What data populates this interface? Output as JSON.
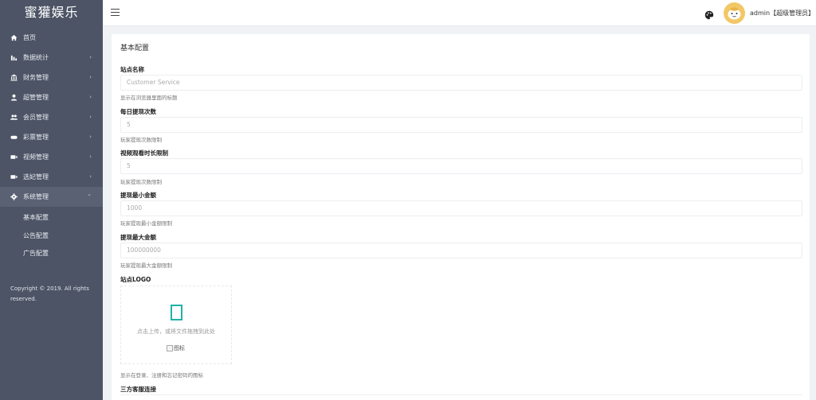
{
  "brand": "蜜獾娱乐",
  "sidebar": {
    "items": [
      {
        "label": "首页",
        "icon": "home-icon",
        "has_children": false
      },
      {
        "label": "数据统计",
        "icon": "bar-chart-icon",
        "has_children": true
      },
      {
        "label": "财务管理",
        "icon": "bank-icon",
        "has_children": true
      },
      {
        "label": "超管管理",
        "icon": "user-icon",
        "has_children": true
      },
      {
        "label": "会员管理",
        "icon": "users-icon",
        "has_children": true
      },
      {
        "label": "彩票管理",
        "icon": "gamepad-icon",
        "has_children": true
      },
      {
        "label": "视频管理",
        "icon": "video-icon",
        "has_children": true
      },
      {
        "label": "选妃管理",
        "icon": "video-icon",
        "has_children": true
      },
      {
        "label": "系统管理",
        "icon": "gear-icon",
        "has_children": true,
        "expanded": true
      }
    ],
    "chevron": "›",
    "chevron_open": "⌄",
    "sub_items": [
      "基本配置",
      "公告配置",
      "广告配置"
    ],
    "copyright": "Copyright © 2019. All rights reserved."
  },
  "header": {
    "user_label": "admin【超级管理员】",
    "caret": "▾"
  },
  "main": {
    "title": "基本配置",
    "fields": [
      {
        "label": "站点名称",
        "placeholder": "Customer Service",
        "help": "显示在浏览器里面的标题"
      },
      {
        "label": "每日提现次数",
        "value": "5",
        "help": "玩家提现次数限制"
      },
      {
        "label": "视频观看时长限制",
        "value": "5",
        "help": "玩家提现次数限制"
      },
      {
        "label": "提现最小金额",
        "value": "1000",
        "help": "玩家提现最小金额限制"
      },
      {
        "label": "提现最大金额",
        "value": "100000000",
        "help": "玩家提现最大金额限制"
      }
    ],
    "logo": {
      "label": "站点LOGO",
      "upload_text": "点击上传，或将文件拖拽到此处",
      "img_alt": "图标",
      "help": "显示在登录、注册和忘记密码的图标"
    },
    "service_label": "三方客服连接"
  },
  "colors": {
    "sidebar_bg": "#4c5465",
    "accent": "#20b2a6",
    "avatar_bg": "#f2c766"
  }
}
